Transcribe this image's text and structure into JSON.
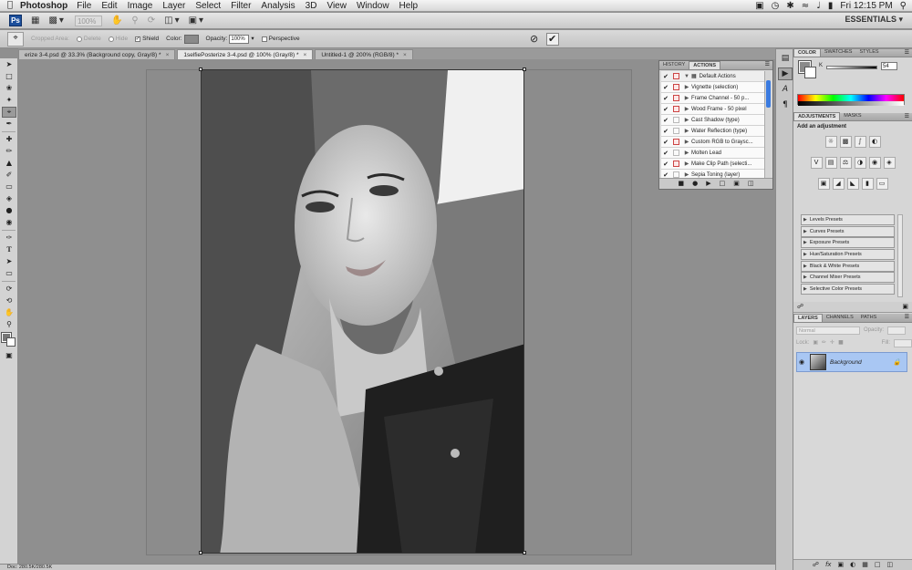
{
  "menubar": {
    "app_name": "Photoshop",
    "menus": [
      "File",
      "Edit",
      "Image",
      "Layer",
      "Select",
      "Filter",
      "Analysis",
      "3D",
      "View",
      "Window",
      "Help"
    ],
    "clock": "Fri 12:15 PM"
  },
  "appbar": {
    "ps_badge": "Ps",
    "zoom": "100%",
    "workspace": "ESSENTIALS"
  },
  "options": {
    "cropped_area_label": "Cropped Area:",
    "delete_label": "Delete",
    "hide_label": "Hide",
    "shield_label": "Shield",
    "color_label": "Color:",
    "opacity_label": "Opacity:",
    "opacity_value": "100%",
    "perspective_label": "Perspective",
    "color_swatch": "#8a8a8a"
  },
  "tabs": [
    {
      "label": "erize 3-4.psd @ 33.3% (Background copy, Gray/8) *"
    },
    {
      "label": "1selfiePosterize 3-4.psd @ 100% (Gray/8) *"
    },
    {
      "label": "Untitled-1 @ 200% (RGB/8) *"
    }
  ],
  "status": {
    "doc": "Doc: 280.5K/280.5K"
  },
  "actions_panel": {
    "tabs": [
      "HISTORY",
      "ACTIONS"
    ],
    "folder": "Default Actions",
    "items": [
      {
        "label": "Vignette (selection)",
        "dialog": true
      },
      {
        "label": "Frame Channel - 50 p...",
        "dialog": true
      },
      {
        "label": "Wood Frame - 50 pixel",
        "dialog": true
      },
      {
        "label": "Cast Shadow (type)",
        "dialog": false
      },
      {
        "label": "Water Reflection (type)",
        "dialog": false
      },
      {
        "label": "Custom RGB to Graysc...",
        "dialog": true
      },
      {
        "label": "Molten Lead",
        "dialog": false
      },
      {
        "label": "Make Clip Path (selecti...",
        "dialog": true
      },
      {
        "label": "Sepia Toning (layer)",
        "dialog": false
      }
    ]
  },
  "color_panel": {
    "tabs": [
      "COLOR",
      "SWATCHES",
      "STYLES"
    ],
    "k_label": "K",
    "k_value": "54"
  },
  "adjustments_panel": {
    "tabs": [
      "ADJUSTMENTS",
      "MASKS"
    ],
    "title": "Add an adjustment",
    "presets": [
      "Levels Presets",
      "Curves Presets",
      "Exposure Presets",
      "Hue/Saturation Presets",
      "Black & White Presets",
      "Channel Mixer Presets",
      "Selective Color Presets"
    ]
  },
  "layers_panel": {
    "tabs": [
      "LAYERS",
      "CHANNELS",
      "PATHS"
    ],
    "blend_mode": "Normal",
    "opacity_label": "Opacity:",
    "lock_label": "Lock:",
    "fill_label": "Fill:",
    "layer_name": "Background"
  }
}
